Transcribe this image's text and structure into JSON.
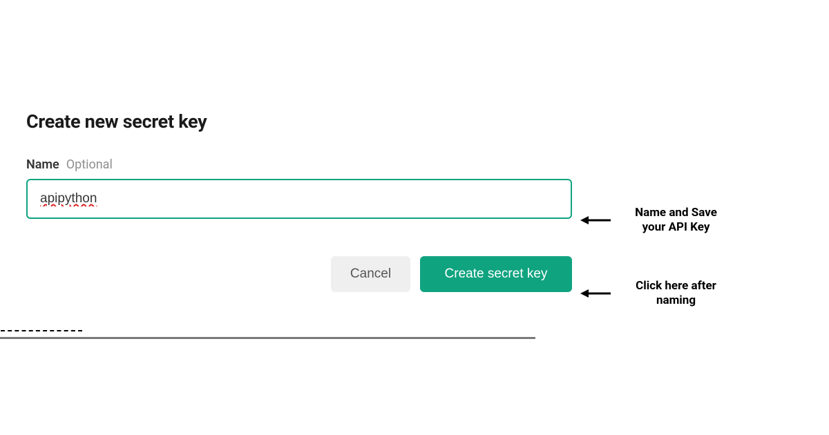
{
  "dialog": {
    "title": "Create new secret key",
    "field_label": "Name",
    "field_optional": "Optional",
    "name_value": "apipython",
    "cancel_label": "Cancel",
    "create_label": "Create secret key"
  },
  "annotations": {
    "a1_line1": "Name and Save",
    "a1_line2": "your API Key",
    "a2_line1": "Click here after",
    "a2_line2": "naming"
  },
  "colors": {
    "accent": "#10a37f"
  }
}
